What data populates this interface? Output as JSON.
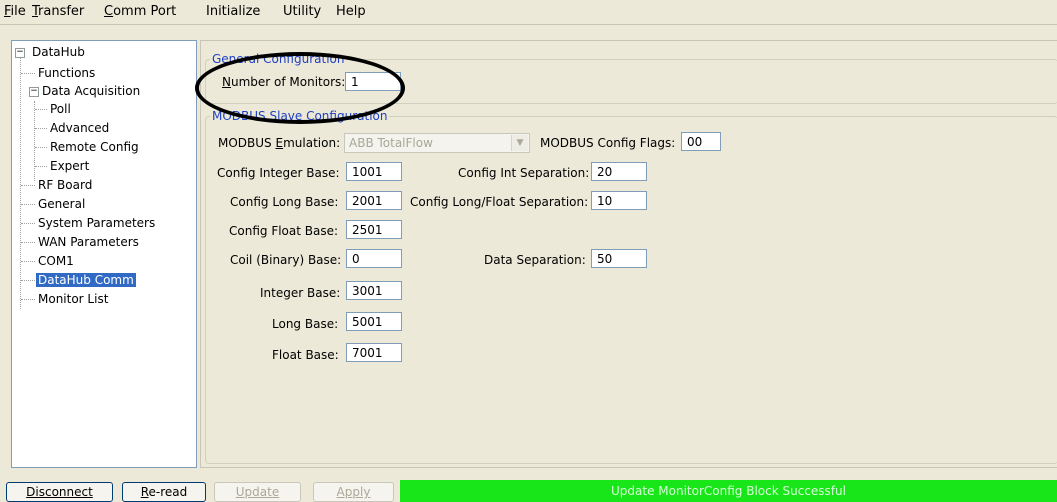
{
  "menu": [
    {
      "label": "File",
      "key": "F",
      "rest": "ile"
    },
    {
      "label": "Transfer",
      "key": "T",
      "rest": "ransfer"
    },
    {
      "label": "Comm Port",
      "key": "C",
      "rest": "omm Port"
    },
    {
      "label": "Initialize",
      "key": "",
      "rest": "Initialize"
    },
    {
      "label": "Utility",
      "key": "",
      "rest": "Utility"
    },
    {
      "label": "Help",
      "key": "",
      "rest": "Help"
    }
  ],
  "tree": {
    "root": "DataHub",
    "items": [
      "Functions",
      "Data Acquisition",
      "Poll",
      "Advanced",
      "Remote Config",
      "Expert",
      "RF Board",
      "General",
      "System Parameters",
      "WAN Parameters",
      "COM1",
      "DataHub Comm",
      "Monitor List"
    ],
    "selected": "DataHub Comm"
  },
  "general": {
    "title": "General Configuration",
    "num_monitors_label_key": "N",
    "num_monitors_label_rest": "umber of Monitors:",
    "num_monitors_value": "1"
  },
  "modbus": {
    "title": "MODBUS Slave Configuration",
    "emulation_label_pre": "MODBUS ",
    "emulation_label_key": "E",
    "emulation_label_rest": "mulation:",
    "emulation_value": "ABB TotalFlow",
    "flags_label": "MODBUS Config Flags:",
    "flags_value": "00",
    "config_integer_base_label": "Config Integer Base:",
    "config_integer_base": "1001",
    "config_long_base_label": "Config Long Base:",
    "config_long_base": "2001",
    "config_float_base_label": "Config Float Base:",
    "config_float_base": "2501",
    "coil_base_label": "Coil (Binary) Base:",
    "coil_base": "0",
    "integer_base_label": "Integer Base:",
    "integer_base": "3001",
    "long_base_label": "Long Base:",
    "long_base": "5001",
    "float_base_label": "Float Base:",
    "float_base": "7001",
    "int_sep_label": "Config Int Separation:",
    "int_sep": "20",
    "longfloat_sep_label": "Config Long/Float Separation:",
    "longfloat_sep": "10",
    "data_sep_label": "Data Separation:",
    "data_sep": "50"
  },
  "buttons": {
    "disconnect": "Disconnect",
    "reread_key": "R",
    "reread_rest": "e-read",
    "update": "Update",
    "apply": "Apply"
  },
  "status": {
    "text": "Update MonitorConfig Block Successful",
    "color": "#19e619"
  }
}
